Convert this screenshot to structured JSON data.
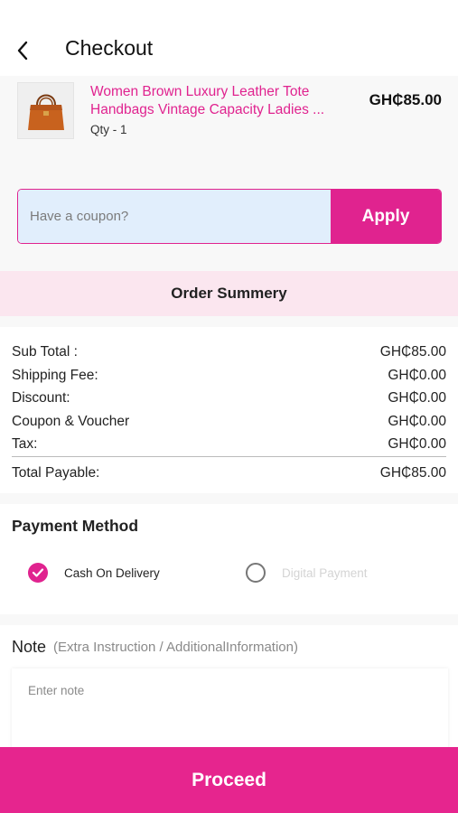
{
  "header": {
    "title": "Checkout"
  },
  "product": {
    "name_line1": "Women Brown Luxury Leather Tote",
    "name_line2": "Handbags Vintage Capacity Ladies ...",
    "qty": "Qty - 1",
    "price": "GH₵85.00"
  },
  "coupon": {
    "placeholder": "Have a coupon?",
    "apply_label": "Apply"
  },
  "summary": {
    "title": "Order Summery",
    "rows": [
      {
        "label": "Sub Total :",
        "value": "GH₵85.00"
      },
      {
        "label": "Shipping Fee:",
        "value": "GH₵0.00"
      },
      {
        "label": "Discount:",
        "value": "GH₵0.00"
      },
      {
        "label": "Coupon & Voucher",
        "value": "GH₵0.00"
      },
      {
        "label": "Tax:",
        "value": "GH₵0.00"
      }
    ],
    "total": {
      "label": "Total Payable:",
      "value": "GH₵85.00"
    }
  },
  "payment": {
    "title": "Payment Method",
    "options": [
      {
        "label": "Cash On Delivery",
        "selected": true
      },
      {
        "label": "Digital Payment",
        "selected": false
      }
    ]
  },
  "note": {
    "title": "Note",
    "subtitle": "(Extra Instruction / AdditionalInformation)",
    "placeholder": "Enter note"
  },
  "proceed_label": "Proceed",
  "colors": {
    "accent": "#e0238f",
    "coupon_bg": "#e1eefc",
    "summary_header_bg": "#fbe6ef"
  }
}
